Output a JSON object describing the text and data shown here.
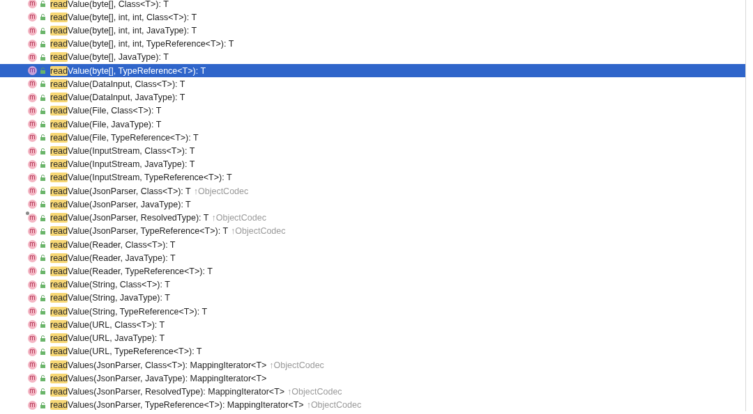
{
  "items": [
    {
      "icon": "m",
      "match": "read",
      "rest": "Value(byte[], Class<T>): T",
      "selected": false,
      "override_mark": false
    },
    {
      "icon": "m",
      "match": "read",
      "rest": "Value(byte[], int, int, Class<T>): T",
      "selected": false,
      "override_mark": false
    },
    {
      "icon": "m",
      "match": "read",
      "rest": "Value(byte[], int, int, JavaType): T",
      "selected": false,
      "override_mark": false
    },
    {
      "icon": "m",
      "match": "read",
      "rest": "Value(byte[], int, int, TypeReference<T>): T",
      "selected": false,
      "override_mark": false
    },
    {
      "icon": "m",
      "match": "read",
      "rest": "Value(byte[], JavaType): T",
      "selected": false,
      "override_mark": false
    },
    {
      "icon": "m",
      "match": "read",
      "rest": "Value(byte[], TypeReference<T>): T",
      "selected": true,
      "override_mark": false
    },
    {
      "icon": "m",
      "match": "read",
      "rest": "Value(DataInput, Class<T>): T",
      "selected": false,
      "override_mark": false
    },
    {
      "icon": "m",
      "match": "read",
      "rest": "Value(DataInput, JavaType): T",
      "selected": false,
      "override_mark": false
    },
    {
      "icon": "m",
      "match": "read",
      "rest": "Value(File, Class<T>): T",
      "selected": false,
      "override_mark": false
    },
    {
      "icon": "m",
      "match": "read",
      "rest": "Value(File, JavaType): T",
      "selected": false,
      "override_mark": false
    },
    {
      "icon": "m",
      "match": "read",
      "rest": "Value(File, TypeReference<T>): T",
      "selected": false,
      "override_mark": false
    },
    {
      "icon": "m",
      "match": "read",
      "rest": "Value(InputStream, Class<T>): T",
      "selected": false,
      "override_mark": false
    },
    {
      "icon": "m",
      "match": "read",
      "rest": "Value(InputStream, JavaType): T",
      "selected": false,
      "override_mark": false
    },
    {
      "icon": "m",
      "match": "read",
      "rest": "Value(InputStream, TypeReference<T>): T",
      "selected": false,
      "override_mark": false
    },
    {
      "icon": "m",
      "match": "read",
      "rest": "Value(JsonParser, Class<T>): T",
      "inherited": "↑ObjectCodec",
      "selected": false,
      "override_mark": false
    },
    {
      "icon": "m",
      "match": "read",
      "rest": "Value(JsonParser, JavaType): T",
      "selected": false,
      "override_mark": false
    },
    {
      "icon": "m",
      "match": "read",
      "rest": "Value(JsonParser, ResolvedType): T",
      "inherited": "↑ObjectCodec",
      "selected": false,
      "override_mark": true
    },
    {
      "icon": "m",
      "match": "read",
      "rest": "Value(JsonParser, TypeReference<T>): T",
      "inherited": "↑ObjectCodec",
      "selected": false,
      "override_mark": false
    },
    {
      "icon": "m",
      "match": "read",
      "rest": "Value(Reader, Class<T>): T",
      "selected": false,
      "override_mark": false
    },
    {
      "icon": "m",
      "match": "read",
      "rest": "Value(Reader, JavaType): T",
      "selected": false,
      "override_mark": false
    },
    {
      "icon": "m",
      "match": "read",
      "rest": "Value(Reader, TypeReference<T>): T",
      "selected": false,
      "override_mark": false
    },
    {
      "icon": "m",
      "match": "read",
      "rest": "Value(String, Class<T>): T",
      "selected": false,
      "override_mark": false
    },
    {
      "icon": "m",
      "match": "read",
      "rest": "Value(String, JavaType): T",
      "selected": false,
      "override_mark": false
    },
    {
      "icon": "m",
      "match": "read",
      "rest": "Value(String, TypeReference<T>): T",
      "selected": false,
      "override_mark": false
    },
    {
      "icon": "m",
      "match": "read",
      "rest": "Value(URL, Class<T>): T",
      "selected": false,
      "override_mark": false
    },
    {
      "icon": "m",
      "match": "read",
      "rest": "Value(URL, JavaType): T",
      "selected": false,
      "override_mark": false
    },
    {
      "icon": "m",
      "match": "read",
      "rest": "Value(URL, TypeReference<T>): T",
      "selected": false,
      "override_mark": false
    },
    {
      "icon": "m",
      "match": "read",
      "rest": "Values(JsonParser, Class<T>): MappingIterator<T>",
      "inherited": "↑ObjectCodec",
      "selected": false,
      "override_mark": false
    },
    {
      "icon": "m",
      "match": "read",
      "rest": "Values(JsonParser, JavaType): MappingIterator<T>",
      "selected": false,
      "override_mark": false
    },
    {
      "icon": "m",
      "match": "read",
      "rest": "Values(JsonParser, ResolvedType): MappingIterator<T>",
      "inherited": "↑ObjectCodec",
      "selected": false,
      "override_mark": false
    },
    {
      "icon": "m",
      "match": "read",
      "rest": "Values(JsonParser, TypeReference<T>): MappingIterator<T>",
      "inherited": "↑ObjectCodec",
      "selected": false,
      "override_mark": false
    }
  ]
}
